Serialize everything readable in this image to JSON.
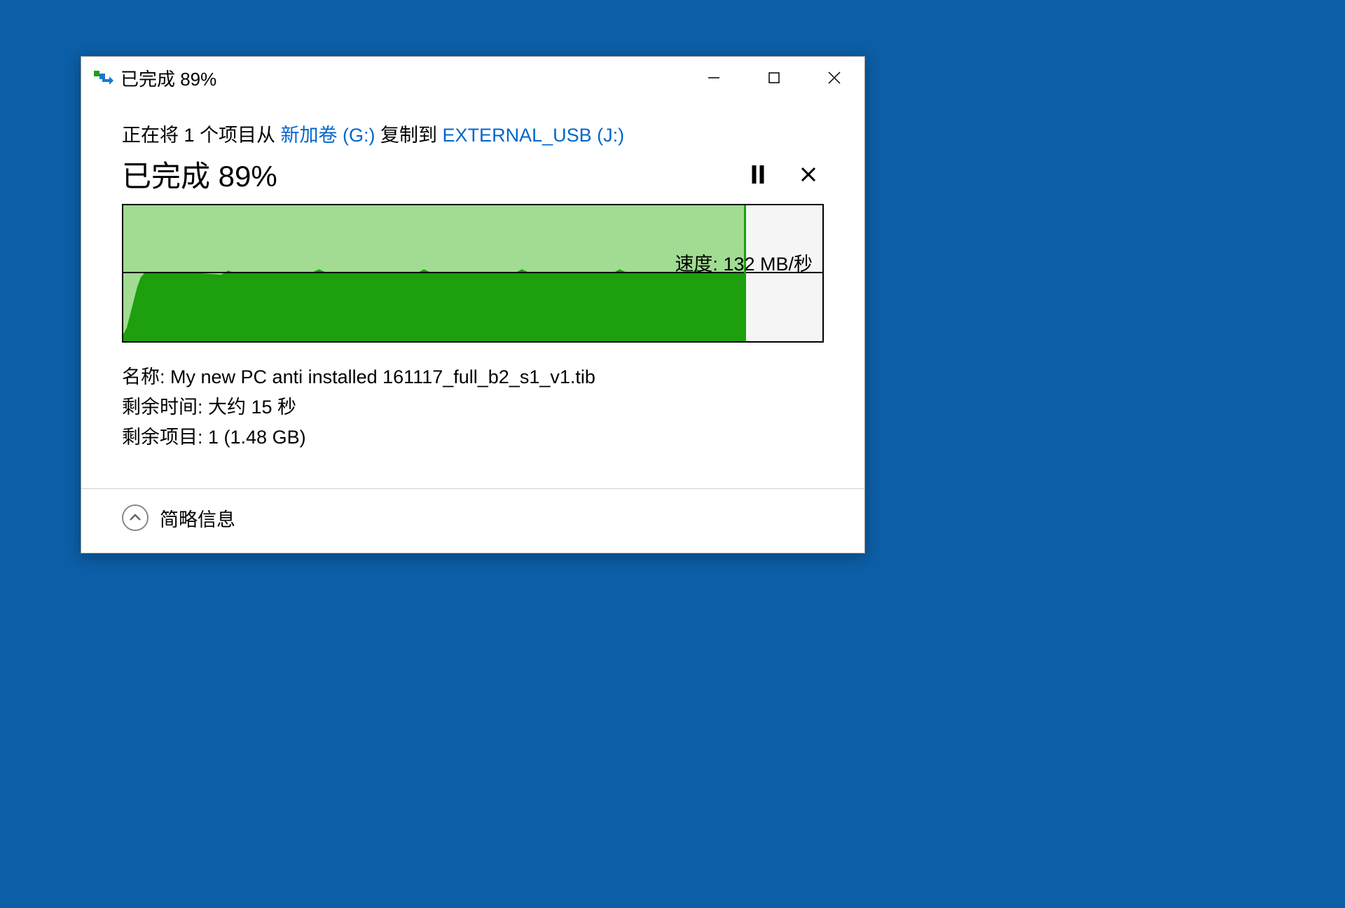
{
  "window": {
    "title": "已完成 89%"
  },
  "copy": {
    "prefix": "正在将 1 个项目从 ",
    "source": "新加卷 (G:)",
    "mid": " 复制到 ",
    "dest": "EXTERNAL_USB (J:)"
  },
  "progress": {
    "text": "已完成 89%",
    "percent": 89
  },
  "chart_data": {
    "type": "area",
    "percent_complete": 89,
    "speed_label": "速度: 132 MB/秒",
    "speed_value_mb_s": 132,
    "speed_line_fraction": 0.49,
    "speed_curve": [
      {
        "x": 0,
        "y": 0.05
      },
      {
        "x": 0.5,
        "y": 0.1
      },
      {
        "x": 1,
        "y": 0.2
      },
      {
        "x": 1.5,
        "y": 0.3
      },
      {
        "x": 2,
        "y": 0.4
      },
      {
        "x": 2.5,
        "y": 0.47
      },
      {
        "x": 3,
        "y": 0.5
      },
      {
        "x": 4,
        "y": 0.51
      },
      {
        "x": 10,
        "y": 0.505
      },
      {
        "x": 14,
        "y": 0.49
      },
      {
        "x": 15,
        "y": 0.52
      },
      {
        "x": 16,
        "y": 0.5
      },
      {
        "x": 27,
        "y": 0.505
      },
      {
        "x": 28,
        "y": 0.53
      },
      {
        "x": 29,
        "y": 0.505
      },
      {
        "x": 42,
        "y": 0.5
      },
      {
        "x": 43,
        "y": 0.53
      },
      {
        "x": 44,
        "y": 0.505
      },
      {
        "x": 56,
        "y": 0.5
      },
      {
        "x": 57,
        "y": 0.53
      },
      {
        "x": 58,
        "y": 0.505
      },
      {
        "x": 70,
        "y": 0.5
      },
      {
        "x": 71,
        "y": 0.53
      },
      {
        "x": 72,
        "y": 0.505
      },
      {
        "x": 81,
        "y": 0.5
      },
      {
        "x": 82,
        "y": 0.53
      },
      {
        "x": 83,
        "y": 0.505
      },
      {
        "x": 89,
        "y": 0.505
      }
    ]
  },
  "details": {
    "name_label": "名称: ",
    "name_value": "My new PC anti installed 161117_full_b2_s1_v1.tib",
    "time_label": "剩余时间: ",
    "time_value": "大约 15 秒",
    "items_label": "剩余项目: ",
    "items_value": "1 (1.48 GB)"
  },
  "footer": {
    "toggle_label": "简略信息"
  }
}
